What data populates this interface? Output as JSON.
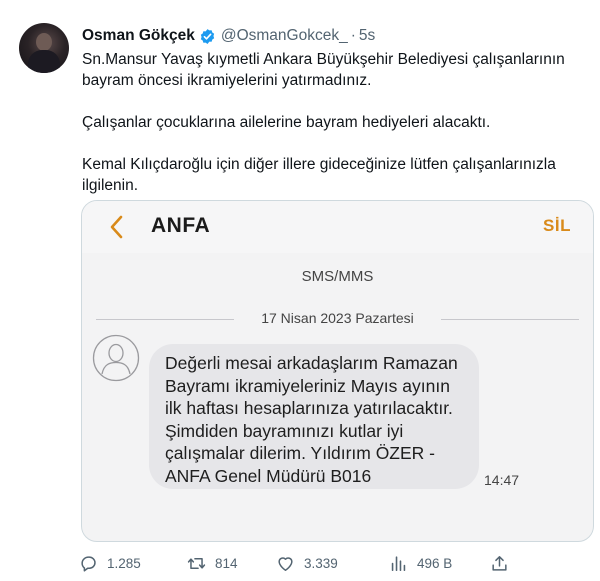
{
  "tweet": {
    "author_name": "Osman Gökçek",
    "author_handle": "@OsmanGokcek_",
    "separator": "·",
    "time": "5s",
    "paragraphs": [
      "Sn.Mansur Yavaş kıymetli Ankara Büyükşehir Belediyesi çalışanlarının bayram öncesi ikramiyelerini yatırmadınız.",
      "Çalışanlar çocuklarına ailelerine bayram hediyeleri alacaktı.",
      "Kemal Kılıçdaroğlu için diğer illere gideceğinize lütfen çalışanlarınızla ilgilenin."
    ]
  },
  "sms_screenshot": {
    "sender": "ANFA",
    "delete_label": "SİL",
    "message_type": "SMS/MMS",
    "date": "17 Nisan 2023 Pazartesi",
    "message_lines": [
      "Değerli mesai arkadaşlarım Ramazan",
      "Bayramı ikramiyeleriniz Mayıs ayının",
      "ilk haftası hesaplarınıza yatırılacaktır.",
      "Şimdiden bayramınızı kutlar iyi",
      "çalışmalar dilerim. Yıldırım ÖZER -",
      "ANFA Genel Müdürü B016"
    ],
    "message_time": "14:47"
  },
  "actions": {
    "replies": "1.285",
    "retweets": "814",
    "likes": "3.339",
    "views": "496 B"
  },
  "colors": {
    "verified_badge": "#1d9bf0",
    "muted_text": "#536471",
    "sms_accent": "#d98a1a"
  }
}
